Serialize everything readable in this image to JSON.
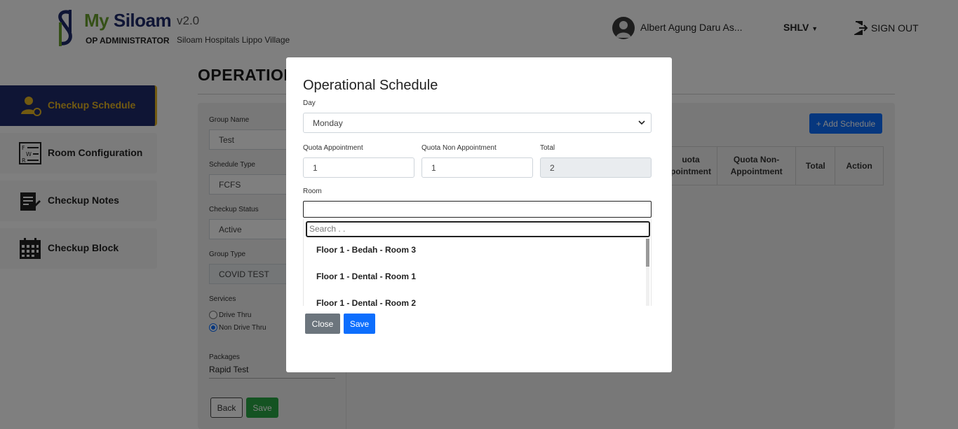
{
  "header": {
    "brand_my": "My",
    "brand_siloam": "Siloam",
    "version": "v2.0",
    "subtitle": "OP ADMINISTRATOR",
    "hospital": "Siloam Hospitals Lippo Village",
    "user_name": "Albert Agung Daru As...",
    "hospital_code": "SHLV",
    "signout_label": "SIGN OUT"
  },
  "sidebar": {
    "items": [
      {
        "label": "Checkup Schedule",
        "icon": "doctor-icon",
        "active": true
      },
      {
        "label": "Room Configuration",
        "icon": "room-config-icon",
        "active": false
      },
      {
        "label": "Checkup Notes",
        "icon": "notes-icon",
        "active": false
      },
      {
        "label": "Checkup Block",
        "icon": "calendar-icon",
        "active": false
      }
    ]
  },
  "page": {
    "title": "OPERATIONAL",
    "form": {
      "group_name_label": "Group Name",
      "group_name_value": "Test",
      "schedule_type_label": "Schedule Type",
      "schedule_type_value": "FCFS",
      "checkup_status_label": "Checkup Status",
      "checkup_status_value": "Active",
      "group_type_label": "Group Type",
      "group_type_value": "COVID TEST",
      "services_label": "Services",
      "service_options": [
        "Drive Thru",
        "Non Drive Thru"
      ],
      "service_selected": "Non Drive Thru",
      "packages_label": "Packages",
      "packages_value": "Rapid Test",
      "back_label": "Back",
      "save_label": "Save"
    },
    "add_schedule_label": "+ Add Schedule",
    "table_headers": [
      "Quota Appointment",
      "Quota Non-Appointment",
      "Total",
      "Action"
    ],
    "table_header_first_visible": "uota\npointment"
  },
  "modal": {
    "title": "Operational Schedule",
    "day_label": "Day",
    "day_value": "Monday",
    "quota_appt_label": "Quota Appointment",
    "quota_appt_value": "1",
    "quota_non_appt_label": "Quota Non Appointment",
    "quota_non_appt_value": "1",
    "total_label": "Total",
    "total_value": "2",
    "room_label": "Room",
    "search_placeholder": "Search . .",
    "room_options": [
      "Floor 1 - Bedah - Room 3",
      "Floor 1 - Dental - Room 1",
      "Floor 1 - Dental - Room 2"
    ],
    "close_label": "Close",
    "save_label": "Save"
  },
  "colors": {
    "brand_green": "#6aa12e",
    "brand_navy": "#1f2a6b",
    "active_gold": "#e5b522",
    "primary_blue": "#0d6efd",
    "success_green": "#28a745",
    "secondary_gray": "#6c757d"
  }
}
